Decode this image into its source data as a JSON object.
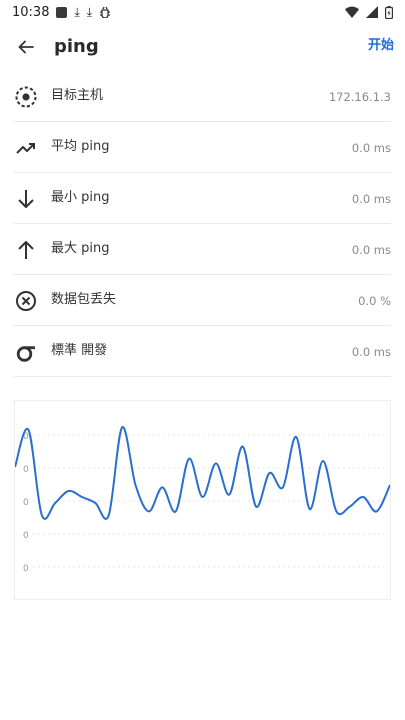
{
  "status_bar": {
    "time": "10:38",
    "icons": [
      "square-notification-icon",
      "download-icon",
      "download-icon",
      "bug-icon"
    ],
    "right_icons": [
      "wifi-icon",
      "signal-icon",
      "battery-icon"
    ]
  },
  "app_bar": {
    "title": "ping",
    "start_label": "开始"
  },
  "rows": [
    {
      "label": "目标主机",
      "value": "172.16.1.3",
      "icon": "target-icon"
    },
    {
      "label": "平均 ping",
      "value": "0.0 ms",
      "icon": "trending-up-icon"
    },
    {
      "label": "最小 ping",
      "value": "0.0 ms",
      "icon": "arrow-down-icon"
    },
    {
      "label": "最大 ping",
      "value": "0.0 ms",
      "icon": "arrow-up-icon"
    },
    {
      "label": "数据包丢失",
      "value": "0.0 %",
      "icon": "close-circle-icon"
    },
    {
      "label": "標準 開發",
      "value": "0.0 ms",
      "icon": "sigma-icon"
    }
  ],
  "colors": {
    "accent": "#1f6ed4",
    "line": "#2a6fd0"
  },
  "chart_data": {
    "type": "line",
    "y_tick_labels": [
      "0",
      "0",
      "0",
      "0",
      "0"
    ],
    "grid": true,
    "series": [
      {
        "values": [
          0.55,
          0.86,
          0.15,
          0.25,
          0.35,
          0.3,
          0.25,
          0.15,
          0.88,
          0.4,
          0.18,
          0.38,
          0.18,
          0.62,
          0.3,
          0.58,
          0.32,
          0.72,
          0.22,
          0.5,
          0.38,
          0.8,
          0.2,
          0.6,
          0.18,
          0.22,
          0.3,
          0.18,
          0.4
        ]
      }
    ]
  }
}
